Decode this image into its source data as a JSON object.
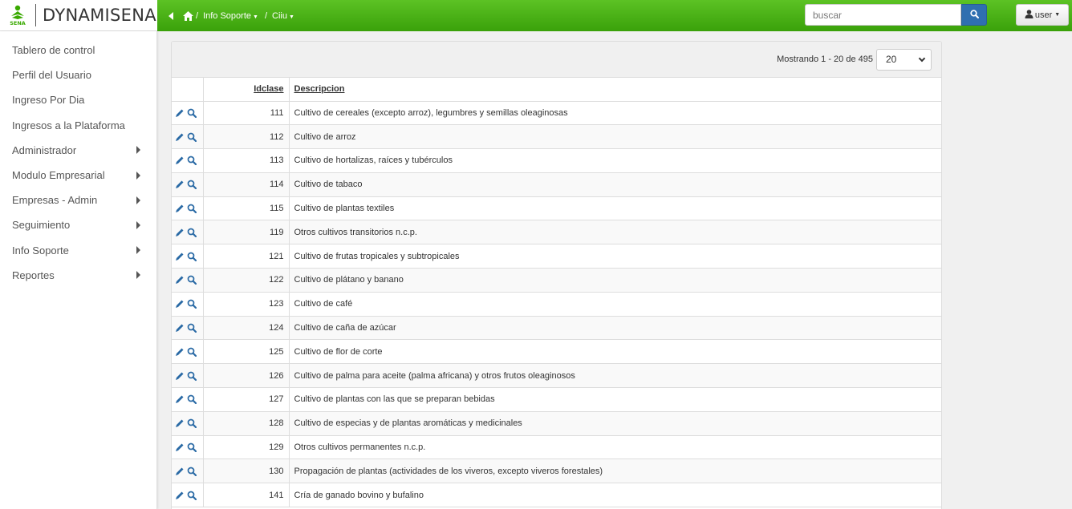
{
  "brand": {
    "name": "DYNAMISENA",
    "logo_text": "SENA"
  },
  "breadcrumb": {
    "item1": "Info Soporte",
    "item2": "Ciiu",
    "separator": "/"
  },
  "search": {
    "placeholder": "buscar"
  },
  "user": {
    "label": "user"
  },
  "sidebar": {
    "items": [
      {
        "label": "Tablero de control",
        "submenu": false
      },
      {
        "label": "Perfil del Usuario",
        "submenu": false
      },
      {
        "label": "Ingreso Por Dia",
        "submenu": false
      },
      {
        "label": "Ingresos a la Plataforma",
        "submenu": false
      },
      {
        "label": "Administrador",
        "submenu": true
      },
      {
        "label": "Modulo Empresarial",
        "submenu": true
      },
      {
        "label": "Empresas - Admin",
        "submenu": true
      },
      {
        "label": "Seguimiento",
        "submenu": true
      },
      {
        "label": "Info Soporte",
        "submenu": true
      },
      {
        "label": "Reportes",
        "submenu": true
      }
    ]
  },
  "pager": {
    "showing": "Mostrando 1 - 20 de 495",
    "page_size": "20"
  },
  "table": {
    "headers": {
      "id": "Idclase",
      "desc": "Descripcion"
    },
    "rows": [
      {
        "id": "111",
        "desc": "Cultivo de cereales (excepto arroz), legumbres y semillas oleaginosas"
      },
      {
        "id": "112",
        "desc": "Cultivo de arroz"
      },
      {
        "id": "113",
        "desc": "Cultivo de hortalizas, raíces y tubérculos"
      },
      {
        "id": "114",
        "desc": "Cultivo de tabaco"
      },
      {
        "id": "115",
        "desc": "Cultivo de plantas textiles"
      },
      {
        "id": "119",
        "desc": "Otros cultivos transitorios n.c.p."
      },
      {
        "id": "121",
        "desc": "Cultivo de frutas tropicales y subtropicales"
      },
      {
        "id": "122",
        "desc": "Cultivo de plátano y banano"
      },
      {
        "id": "123",
        "desc": "Cultivo de café"
      },
      {
        "id": "124",
        "desc": "Cultivo de caña de azúcar"
      },
      {
        "id": "125",
        "desc": "Cultivo de flor de corte"
      },
      {
        "id": "126",
        "desc": "Cultivo de palma para aceite (palma africana) y otros frutos oleaginosos"
      },
      {
        "id": "127",
        "desc": "Cultivo de plantas con las que se preparan bebidas"
      },
      {
        "id": "128",
        "desc": "Cultivo de especias y de plantas aromáticas y medicinales"
      },
      {
        "id": "129",
        "desc": "Otros cultivos permanentes n.c.p."
      },
      {
        "id": "130",
        "desc": "Propagación de plantas (actividades de los viveros, excepto viveros forestales)"
      },
      {
        "id": "141",
        "desc": "Cría de ganado bovino y bufalino"
      }
    ]
  },
  "colors": {
    "topbar": "#3aa10a",
    "search_button": "#2f6fb0",
    "icon": "#2a6aa5"
  },
  "icons": {
    "edit": "pencil-icon",
    "view": "magnifier-icon",
    "home": "home-icon",
    "user": "user-icon",
    "search": "search-icon"
  }
}
